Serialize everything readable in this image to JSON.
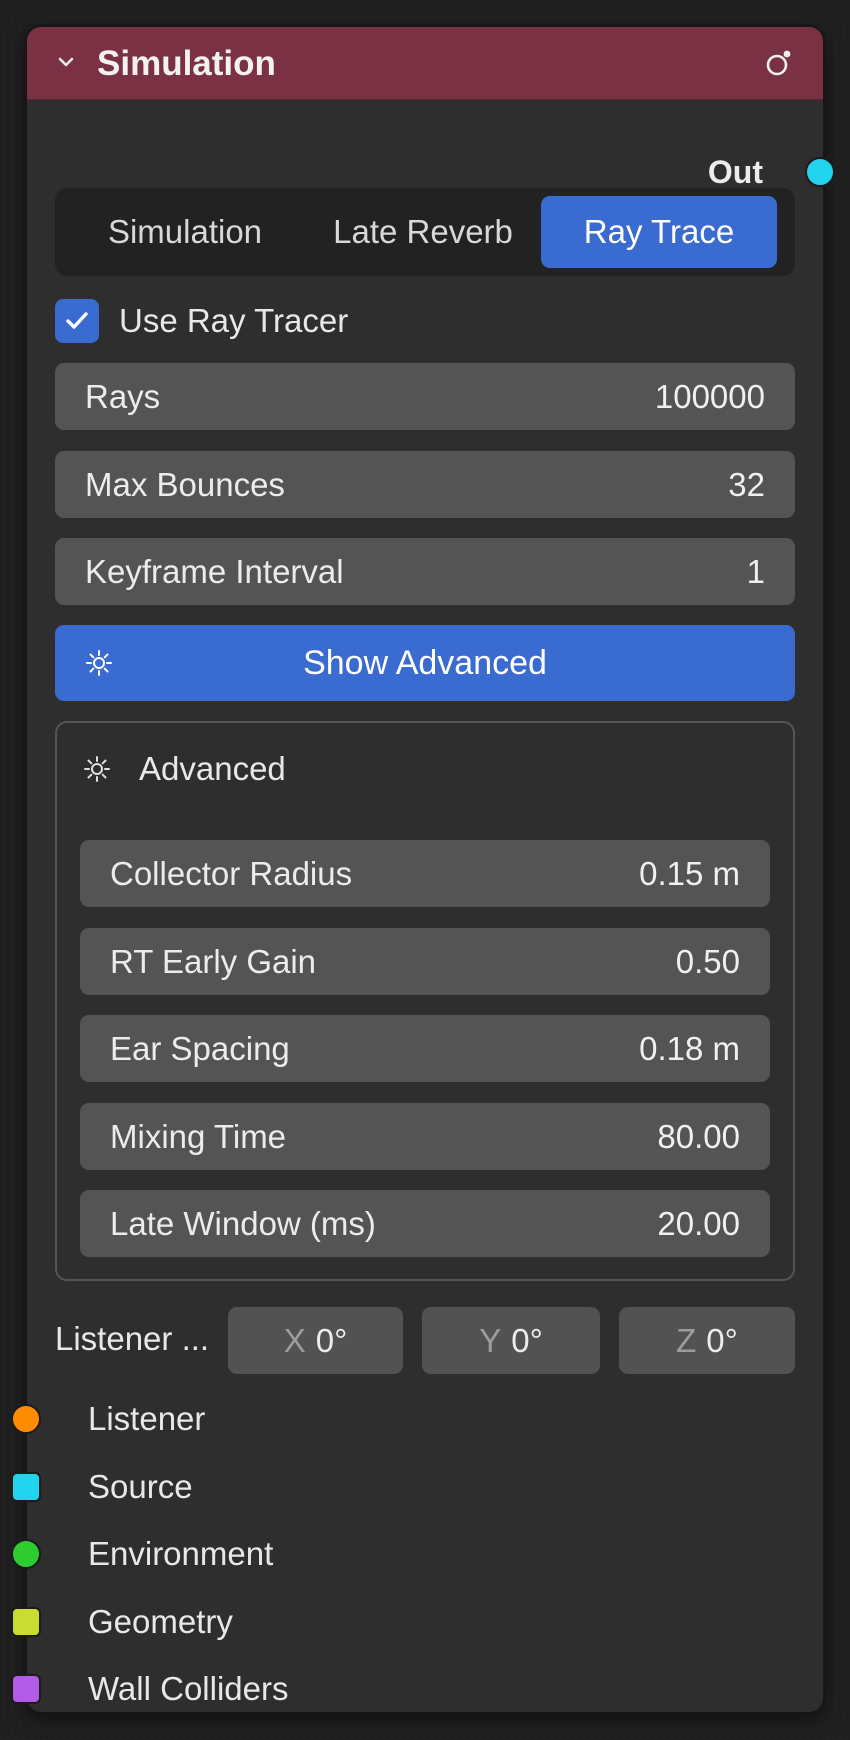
{
  "node": {
    "title": "Simulation",
    "header_color": "#7b3144",
    "output_label": "Out"
  },
  "tabs": [
    {
      "label": "Simulation",
      "active": false
    },
    {
      "label": "Late Reverb",
      "active": false
    },
    {
      "label": "Ray Trace",
      "active": true
    }
  ],
  "use_ray_tracer": {
    "label": "Use Ray Tracer",
    "checked": true
  },
  "fields": [
    {
      "label": "Rays",
      "value": "100000"
    },
    {
      "label": "Max Bounces",
      "value": "32"
    },
    {
      "label": "Keyframe Interval",
      "value": "1"
    }
  ],
  "show_advanced": {
    "label": "Show Advanced",
    "icon": "sun-icon"
  },
  "advanced": {
    "title": "Advanced",
    "icon": "sun-icon",
    "fields": [
      {
        "label": "Collector Radius",
        "value": "0.15 m"
      },
      {
        "label": "RT Early Gain",
        "value": "0.50"
      },
      {
        "label": "Ear Spacing",
        "value": "0.18 m"
      },
      {
        "label": "Mixing Time",
        "value": "80.00"
      },
      {
        "label": "Late Window (ms)",
        "value": "20.00"
      }
    ]
  },
  "listener_rotation": {
    "label": "Listener ...",
    "x": {
      "axis": "X",
      "value": "0°"
    },
    "y": {
      "axis": "Y",
      "value": "0°"
    },
    "z": {
      "axis": "Z",
      "value": "0°"
    }
  },
  "inputs": [
    {
      "label": "Listener",
      "socket_color": "#ff8c00",
      "socket_shape": "circle"
    },
    {
      "label": "Source",
      "socket_color": "#22d3ee",
      "socket_shape": "square"
    },
    {
      "label": "Environment",
      "socket_color": "#2ecc2e",
      "socket_shape": "circle"
    },
    {
      "label": "Geometry",
      "socket_color": "#c8dc32",
      "socket_shape": "square"
    },
    {
      "label": "Wall Colliders",
      "socket_color": "#b05ce6",
      "socket_shape": "square"
    }
  ],
  "colors": {
    "accent": "#3a6bd1",
    "output_socket": "#22d3ee"
  }
}
